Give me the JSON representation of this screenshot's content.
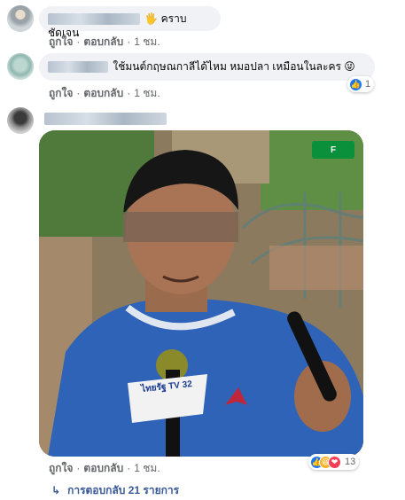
{
  "comments": [
    {
      "text": "🖐 คราบชัดเจน",
      "actions": {
        "like": "ถูกใจ",
        "reply": "ตอบกลับ",
        "time": "1 ชม."
      }
    },
    {
      "text": "ใช้มนต์กฤษณกาลีได้ไหม หมอปลา เหมือนในละคร 😜",
      "actions": {
        "like": "ถูกใจ",
        "reply": "ตอบกลับ",
        "time": "1 ชม."
      },
      "reaction_count": "1"
    },
    {
      "photo_watermark": "ไทยรัฐ TV 32",
      "actions": {
        "like": "ถูกใจ",
        "reply": "ตอบกลับ",
        "time": "1 ชม."
      },
      "reaction_count": "13"
    }
  ],
  "replies_link": "การตอบกลับ 21 รายการ",
  "separator": "·",
  "reply_arrow": "↳",
  "colors": {
    "like_blue": "#1877f2",
    "haha_yellow": "#f7b125",
    "love_red": "#f33e58",
    "link_blue": "#385898"
  }
}
